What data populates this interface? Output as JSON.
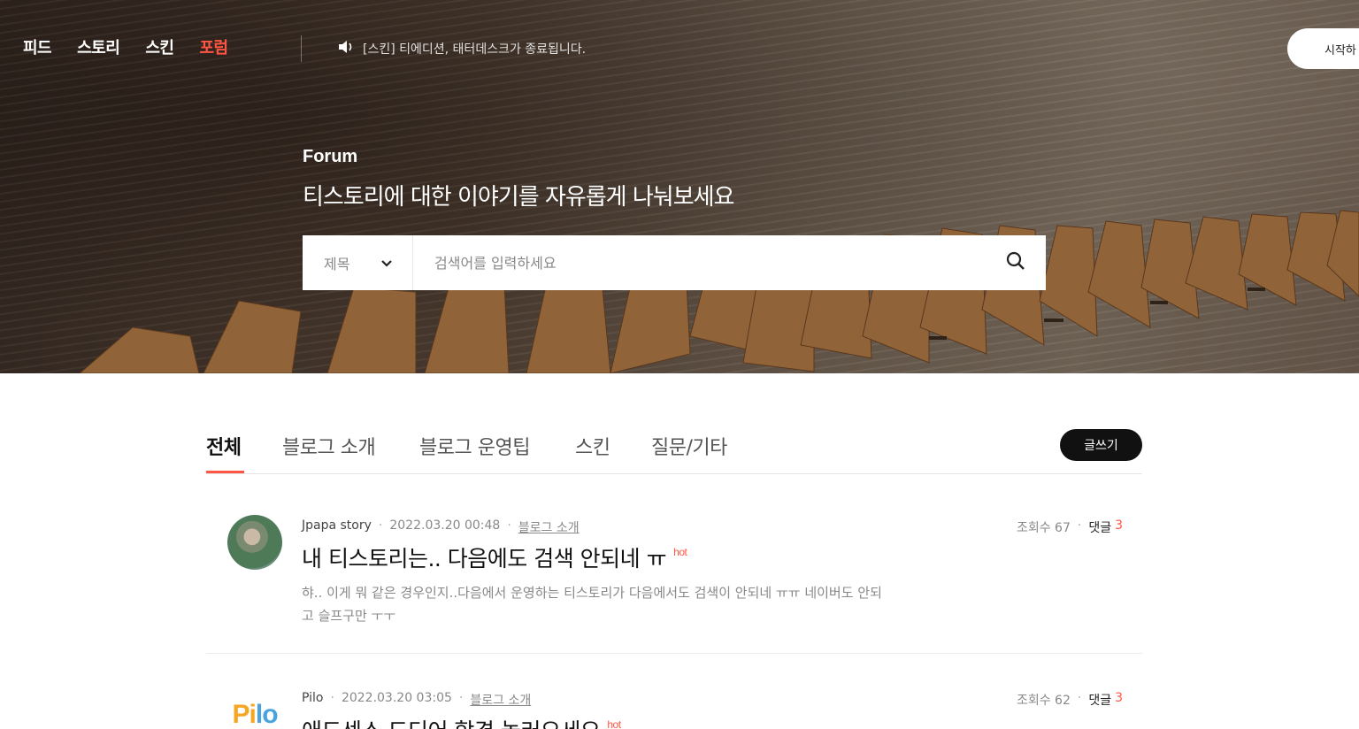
{
  "nav": {
    "items": [
      {
        "label": "피드",
        "active": false
      },
      {
        "label": "스토리",
        "active": false
      },
      {
        "label": "스킨",
        "active": false
      },
      {
        "label": "포럼",
        "active": true
      }
    ],
    "notice": "[스킨] 티에디션, 태터데스크가 종료됩니다.",
    "notice_icon": "speaker-icon",
    "start_label": "시작하"
  },
  "hero": {
    "label": "Forum",
    "subtitle": "티스토리에 대한 이야기를 자유롭게 나눠보세요"
  },
  "search": {
    "select_value": "제목",
    "placeholder": "검색어를 입력하세요",
    "icon": "search-icon"
  },
  "tabs": {
    "items": [
      "전체",
      "블로그 소개",
      "블로그 운영팁",
      "스킨",
      "질문/기타"
    ],
    "active_index": 0,
    "write_label": "글쓰기"
  },
  "colors": {
    "accent": "#ff5544",
    "dark": "#111111"
  },
  "posts": [
    {
      "author": "Jpapa story",
      "date": "2022.03.20 00:48",
      "category": "블로그 소개",
      "views": "조회수 67",
      "comments_label": "댓글",
      "comments": "3",
      "title": "내 티스토리는.. 다음에도 검색 안되네 ㅠ",
      "hot": "hot",
      "excerpt": "햐.. 이게 뭐 같은 경우인지..다음에서 운영하는 티스토리가 다음에서도 검색이 안되네 ㅠㅠ 네이버도 안되고 슬프구만 ㅜㅜ"
    },
    {
      "author": "Pilo",
      "date": "2022.03.20 03:05",
      "category": "블로그 소개",
      "views": "조회수 62",
      "comments_label": "댓글",
      "comments": "3",
      "title": "애드센스 드디어 합격 놀러오세요",
      "hot": "hot",
      "avatar_text": [
        "P",
        "i",
        "l",
        "o"
      ]
    }
  ]
}
